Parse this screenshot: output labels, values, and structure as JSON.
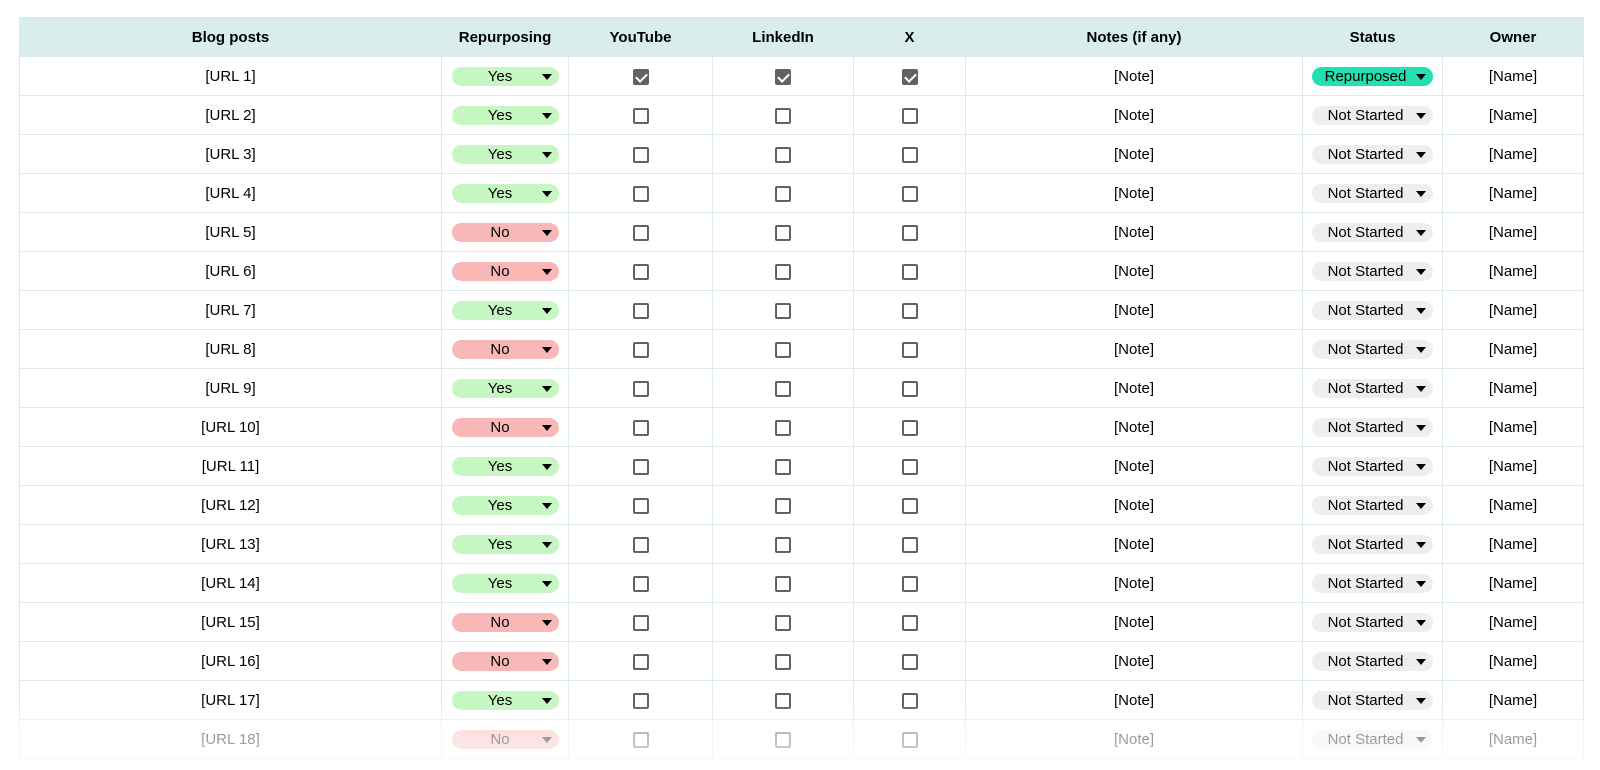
{
  "table": {
    "headers": [
      "Blog posts",
      "Repurposing",
      "YouTube",
      "LinkedIn",
      "X",
      "Notes (if any)",
      "Status",
      "Owner"
    ],
    "rows": [
      {
        "url": "[URL 1]",
        "repurposing": "Yes",
        "youtube": true,
        "linkedin": true,
        "x": true,
        "note": "[Note]",
        "status": "Repurposed",
        "owner": "[Name]"
      },
      {
        "url": "[URL 2]",
        "repurposing": "Yes",
        "youtube": false,
        "linkedin": false,
        "x": false,
        "note": "[Note]",
        "status": "Not Started",
        "owner": "[Name]"
      },
      {
        "url": "[URL 3]",
        "repurposing": "Yes",
        "youtube": false,
        "linkedin": false,
        "x": false,
        "note": "[Note]",
        "status": "Not Started",
        "owner": "[Name]"
      },
      {
        "url": "[URL 4]",
        "repurposing": "Yes",
        "youtube": false,
        "linkedin": false,
        "x": false,
        "note": "[Note]",
        "status": "Not Started",
        "owner": "[Name]"
      },
      {
        "url": "[URL 5]",
        "repurposing": "No",
        "youtube": false,
        "linkedin": false,
        "x": false,
        "note": "[Note]",
        "status": "Not Started",
        "owner": "[Name]"
      },
      {
        "url": "[URL 6]",
        "repurposing": "No",
        "youtube": false,
        "linkedin": false,
        "x": false,
        "note": "[Note]",
        "status": "Not Started",
        "owner": "[Name]"
      },
      {
        "url": "[URL 7]",
        "repurposing": "Yes",
        "youtube": false,
        "linkedin": false,
        "x": false,
        "note": "[Note]",
        "status": "Not Started",
        "owner": "[Name]"
      },
      {
        "url": "[URL 8]",
        "repurposing": "No",
        "youtube": false,
        "linkedin": false,
        "x": false,
        "note": "[Note]",
        "status": "Not Started",
        "owner": "[Name]"
      },
      {
        "url": "[URL 9]",
        "repurposing": "Yes",
        "youtube": false,
        "linkedin": false,
        "x": false,
        "note": "[Note]",
        "status": "Not Started",
        "owner": "[Name]"
      },
      {
        "url": "[URL 10]",
        "repurposing": "No",
        "youtube": false,
        "linkedin": false,
        "x": false,
        "note": "[Note]",
        "status": "Not Started",
        "owner": "[Name]"
      },
      {
        "url": "[URL 11]",
        "repurposing": "Yes",
        "youtube": false,
        "linkedin": false,
        "x": false,
        "note": "[Note]",
        "status": "Not Started",
        "owner": "[Name]"
      },
      {
        "url": "[URL 12]",
        "repurposing": "Yes",
        "youtube": false,
        "linkedin": false,
        "x": false,
        "note": "[Note]",
        "status": "Not Started",
        "owner": "[Name]"
      },
      {
        "url": "[URL 13]",
        "repurposing": "Yes",
        "youtube": false,
        "linkedin": false,
        "x": false,
        "note": "[Note]",
        "status": "Not Started",
        "owner": "[Name]"
      },
      {
        "url": "[URL 14]",
        "repurposing": "Yes",
        "youtube": false,
        "linkedin": false,
        "x": false,
        "note": "[Note]",
        "status": "Not Started",
        "owner": "[Name]"
      },
      {
        "url": "[URL 15]",
        "repurposing": "No",
        "youtube": false,
        "linkedin": false,
        "x": false,
        "note": "[Note]",
        "status": "Not Started",
        "owner": "[Name]"
      },
      {
        "url": "[URL 16]",
        "repurposing": "No",
        "youtube": false,
        "linkedin": false,
        "x": false,
        "note": "[Note]",
        "status": "Not Started",
        "owner": "[Name]"
      },
      {
        "url": "[URL 17]",
        "repurposing": "Yes",
        "youtube": false,
        "linkedin": false,
        "x": false,
        "note": "[Note]",
        "status": "Not Started",
        "owner": "[Name]"
      },
      {
        "url": "[URL 18]",
        "repurposing": "No",
        "youtube": false,
        "linkedin": false,
        "x": false,
        "note": "[Note]",
        "status": "Not Started",
        "owner": "[Name]"
      }
    ]
  },
  "colors": {
    "header_bg": "#d9eeec",
    "grid": "#dcebe9",
    "yes_chip": "#c6f6c1",
    "no_chip": "#f8b8b8",
    "status_repurposed": "#22e0b0",
    "status_not_started": "#eeeeee",
    "checkbox": "#5f6368"
  },
  "icons": {
    "dropdown": "caret-down-icon",
    "checkbox_checked": "checkbox-checked-icon",
    "checkbox_unchecked": "checkbox-unchecked-icon"
  }
}
